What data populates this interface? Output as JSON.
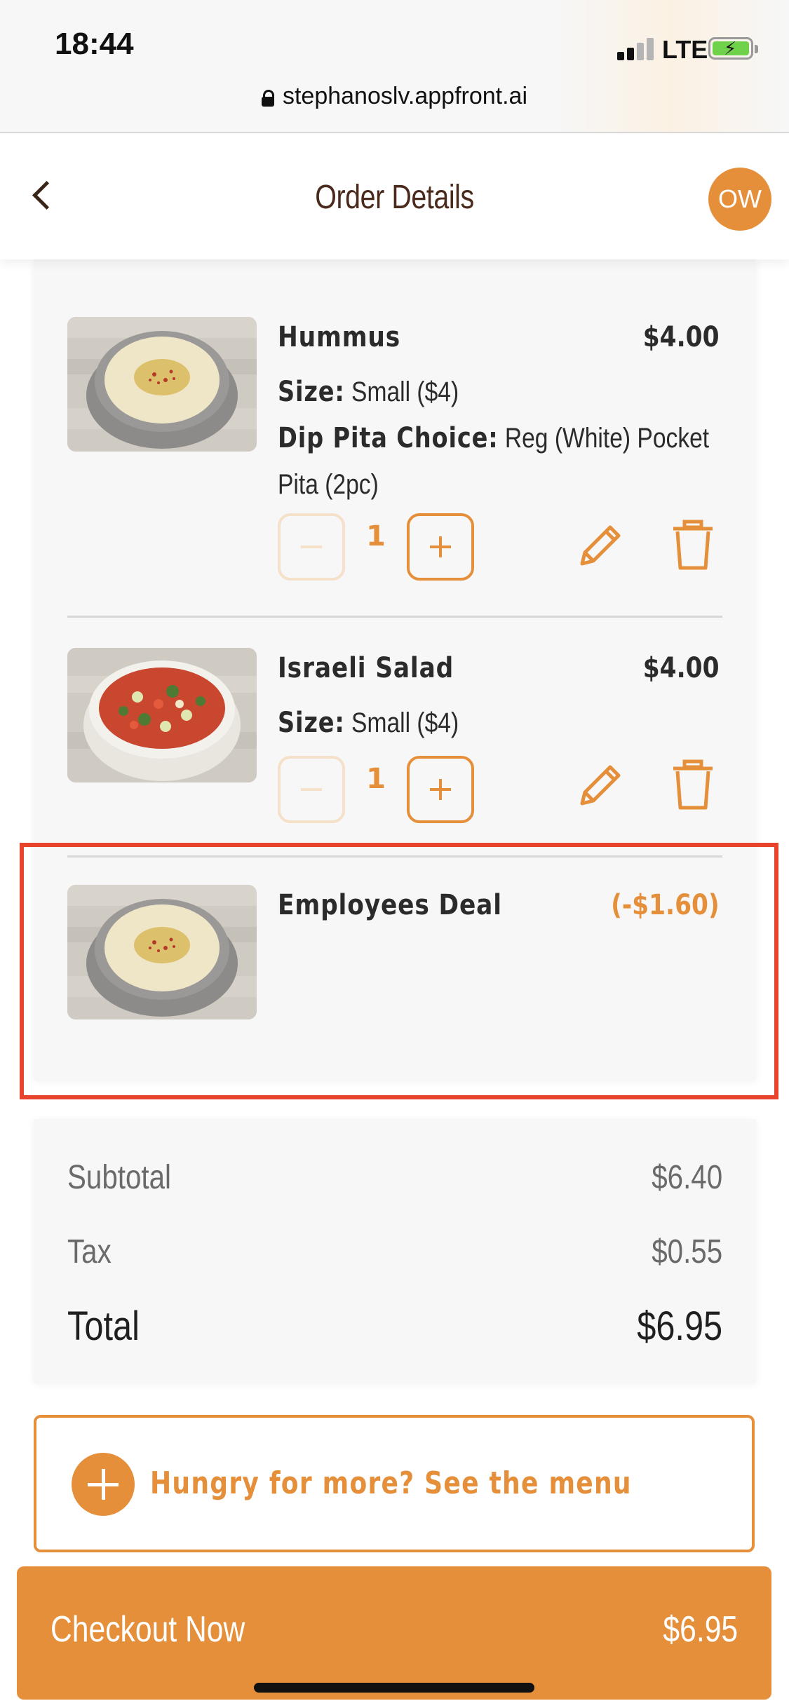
{
  "status_bar": {
    "time": "18:44",
    "network": "LTE",
    "url": "stephanoslv.appfront.ai"
  },
  "header": {
    "title": "Order Details",
    "avatar_initials": "OW"
  },
  "cart": {
    "items": [
      {
        "name": "Hummus",
        "price": "$4.00",
        "options": [
          {
            "label": "Size:",
            "value": "Small ($4)"
          },
          {
            "label": "Dip Pita Choice:",
            "value": "Reg (White) Pocket Pita (2pc)"
          }
        ],
        "quantity": "1"
      },
      {
        "name": "Israeli Salad",
        "price": "$4.00",
        "options": [
          {
            "label": "Size:",
            "value": "Small ($4)"
          }
        ],
        "quantity": "1"
      },
      {
        "name": "Employees Deal",
        "price": "(-$1.60)"
      }
    ]
  },
  "totals": {
    "subtotal_label": "Subtotal",
    "subtotal_value": "$6.40",
    "tax_label": "Tax",
    "tax_value": "$0.55",
    "total_label": "Total",
    "total_value": "$6.95"
  },
  "menu_prompt": "Hungry for more? See the menu",
  "checkout": {
    "label": "Checkout Now",
    "price": "$6.95"
  },
  "colors": {
    "accent": "#e58f3a",
    "highlight": "#e8432c",
    "title": "#4a2a1c"
  },
  "icons": {
    "edit": "pencil-icon",
    "delete": "trash-icon",
    "back": "chevron-left-icon",
    "add": "plus-icon"
  }
}
